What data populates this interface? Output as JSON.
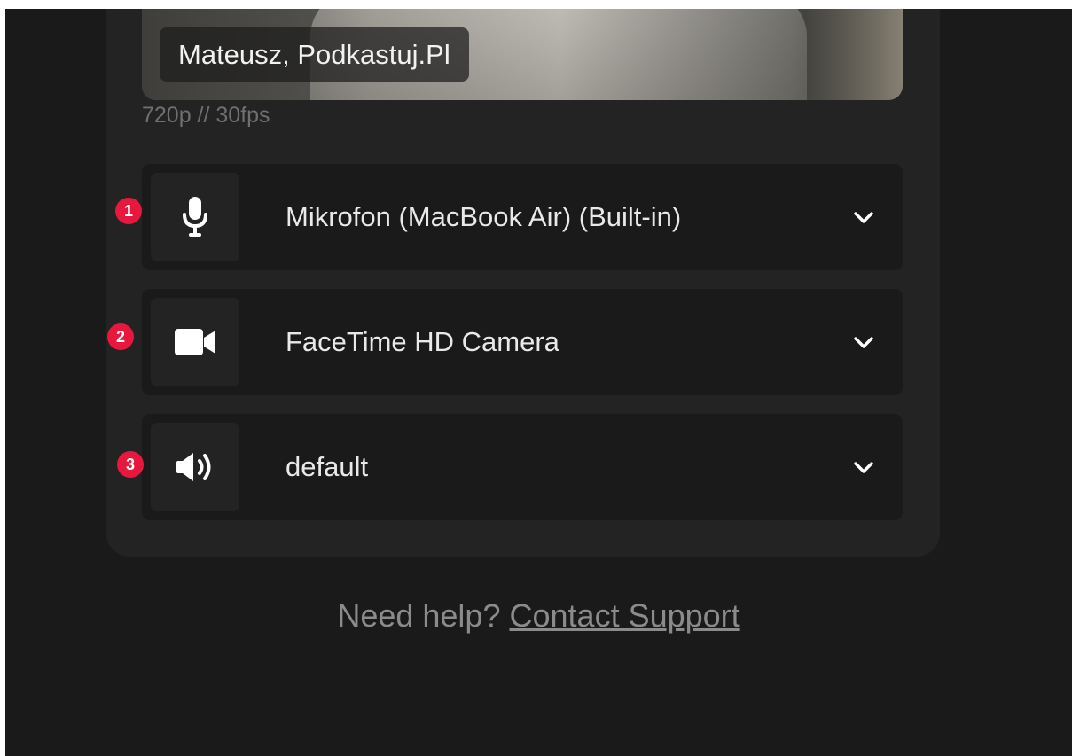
{
  "preview": {
    "participant_name": "Mateusz, Podkastuj.Pl",
    "resolution": "720p // 30fps"
  },
  "devices": [
    {
      "badge": "1",
      "icon": "microphone-icon",
      "label": "Mikrofon (MacBook Air) (Built-in)"
    },
    {
      "badge": "2",
      "icon": "video-camera-icon",
      "label": "FaceTime HD Camera"
    },
    {
      "badge": "3",
      "icon": "speaker-icon",
      "label": "default"
    }
  ],
  "help": {
    "prompt": "Need help?",
    "link_label": "Contact Support"
  },
  "colors": {
    "background": "#1a1a1a",
    "panel": "#232323",
    "badge": "#e8173d",
    "text": "#e9e9e9",
    "muted": "#8b8b8b"
  }
}
